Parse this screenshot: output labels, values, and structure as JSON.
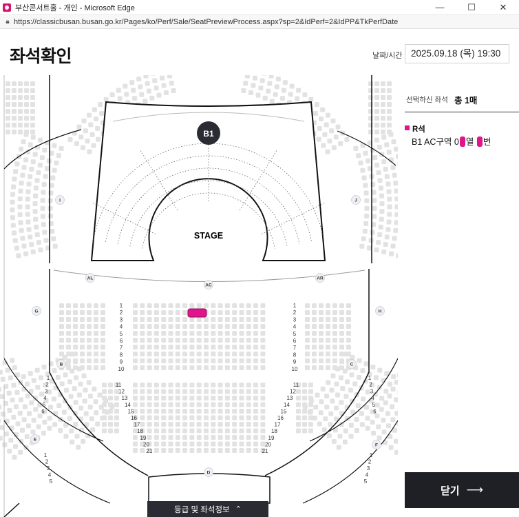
{
  "window": {
    "title": "부산콘서트홀 - 개인 - Microsoft Edge",
    "controls": {
      "minimize": "—",
      "maximize": "☐",
      "close": "✕"
    }
  },
  "address_bar": {
    "url": "https://classicbusan.busan.go.kr/Pages/ko/Perf/Sale/SeatPreviewProcess.aspx?sp=2&IdPerf=2&IdPP&TkPerfDate"
  },
  "header": {
    "title": "좌석확인",
    "date_label": "날짜/시간",
    "date_value": "2025.09.18 (목) 19:30"
  },
  "selection": {
    "label": "선택하신 좌석",
    "count": "총 1매",
    "grade": "R석",
    "grade_color": "#e0158c",
    "seat_prefix": "B1 AC구역 0",
    "row_suffix": "열",
    "seat_suffix": "번"
  },
  "seat_map": {
    "stage_label": "STAGE",
    "b1_label": "B1",
    "zone_labels": {
      "I": "I",
      "J": "J",
      "G": "G",
      "H": "H",
      "B": "B",
      "C": "C",
      "E": "E",
      "F": "F",
      "AL": "AL",
      "AC": "AC",
      "AR": "AR",
      "D": "D"
    },
    "highlight_color": "#e0158c"
  },
  "actions": {
    "close_label": "닫기",
    "close_arrow": "⟶",
    "grade_info_label": "등급 및 좌석정보",
    "grade_info_chevron": "⌃"
  }
}
